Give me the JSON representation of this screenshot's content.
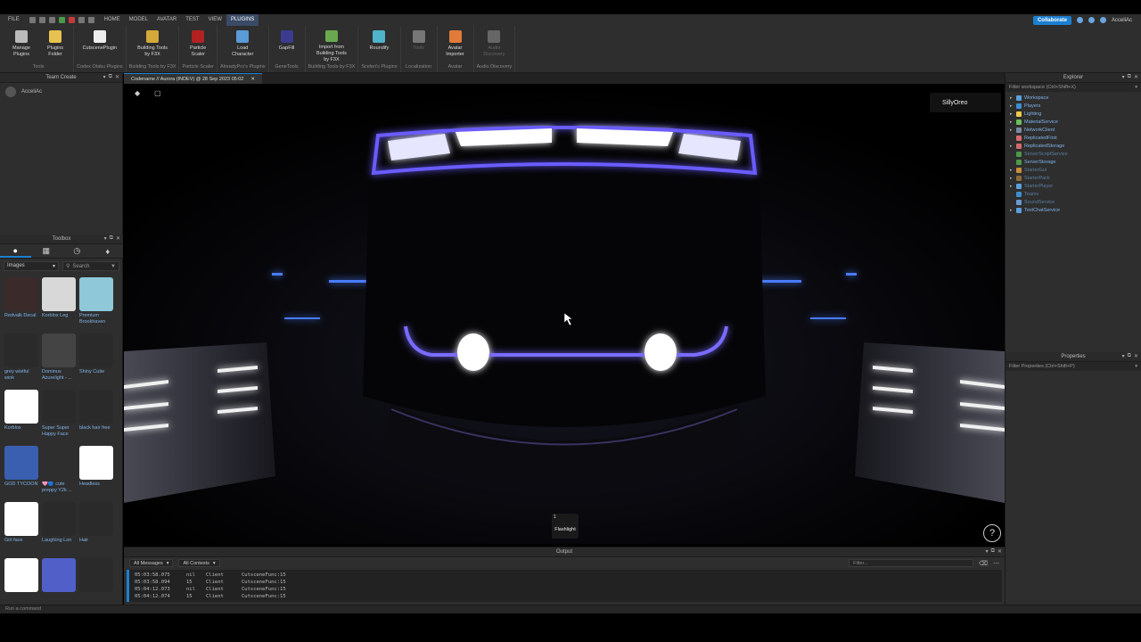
{
  "menu": {
    "items": [
      "FILE",
      "HOME",
      "MODEL",
      "AVATAR",
      "TEST",
      "VIEW",
      "PLUGINS"
    ],
    "active": "PLUGINS",
    "collaborate_label": "Collaborate",
    "username": "AcceliAc"
  },
  "ribbon": {
    "groups": [
      {
        "label": "Tools",
        "buttons": [
          {
            "label": "Manage Plugins",
            "icon": "plugins-gear-icon",
            "color": "#bbbbbb"
          },
          {
            "label": "Plugins Folder",
            "icon": "folder-icon",
            "color": "#e8c250"
          }
        ]
      },
      {
        "label": "Codex Otaku Plugins",
        "buttons": [
          {
            "label": "CutscenePlugin",
            "icon": "camera-icon",
            "color": "#eeeeee"
          }
        ]
      },
      {
        "label": "Building Tools by F3X",
        "buttons": [
          {
            "label": "Building Tools by F3X",
            "icon": "f3x-icon",
            "color": "#d4a93a"
          }
        ]
      },
      {
        "label": "Particle Scaler",
        "buttons": [
          {
            "label": "Particle Scaler",
            "icon": "particle-icon",
            "color": "#b22222"
          }
        ]
      },
      {
        "label": "AlreadyPro's Plugins",
        "buttons": [
          {
            "label": "Load Character",
            "icon": "character-icon",
            "color": "#5a9ad6"
          }
        ]
      },
      {
        "label": "GeneTools",
        "buttons": [
          {
            "label": "GapFill",
            "icon": "gapfill-icon",
            "color": "#3b3b8f"
          }
        ]
      },
      {
        "label": "Building Tools by F3X",
        "buttons": [
          {
            "label": "Import from Building Tools by F3X",
            "icon": "import-icon",
            "color": "#6aa84f"
          }
        ]
      },
      {
        "label": "Sceleri's Plugins",
        "buttons": [
          {
            "label": "Roundify",
            "icon": "roundify-icon",
            "color": "#4fb3c9"
          }
        ]
      },
      {
        "label": "Localization",
        "buttons": [
          {
            "label": "Tools",
            "icon": "localization-icon",
            "color": "#777777",
            "dim": true
          }
        ]
      },
      {
        "label": "Avatar",
        "buttons": [
          {
            "label": "Avatar Importer",
            "icon": "avatar-importer-icon",
            "color": "#e07b39"
          }
        ]
      },
      {
        "label": "Audio Discovery",
        "buttons": [
          {
            "label": "Audio Discovery",
            "icon": "audio-icon",
            "color": "#666666",
            "dim": true
          }
        ]
      }
    ]
  },
  "team_create": {
    "title": "Team Create",
    "user": "AcceliAc"
  },
  "toolbox": {
    "title": "Toolbox",
    "category": "Images",
    "search_placeholder": "Search",
    "items": [
      {
        "name": "Redvalk Decal",
        "color": "#3a2a2a"
      },
      {
        "name": "Korblox Leg",
        "color": "#d8d8d8"
      },
      {
        "name": "Premium Brookhaven",
        "color": "#8fc8d8"
      },
      {
        "name": "grey wistful wink",
        "color": "#2a2a2a"
      },
      {
        "name": "Dominus Azurelight - ...",
        "color": "#444444"
      },
      {
        "name": "Shiny Cutie",
        "color": "#2a2a2a"
      },
      {
        "name": "Korblox",
        "color": "#ffffff"
      },
      {
        "name": "Super Super Happy Face",
        "color": "#2a2a2a"
      },
      {
        "name": "black hair free",
        "color": "#2a2a2a"
      },
      {
        "name": "GOD TYCOON",
        "color": "#3a5fb0"
      },
      {
        "name": "🩷🔵 cute preppy Y2k ...",
        "color": "#2e2e2e"
      },
      {
        "name": "Headless",
        "color": "#ffffff"
      },
      {
        "name": "Girl face",
        "color": "#ffffff"
      },
      {
        "name": "Laughing Lon",
        "color": "#2a2a2a"
      },
      {
        "name": "Hair",
        "color": "#2a2a2a"
      },
      {
        "name": "",
        "color": "#ffffff"
      },
      {
        "name": "",
        "color": "#5060c8"
      },
      {
        "name": "",
        "color": "#2a2a2a"
      }
    ]
  },
  "document_tab": {
    "title": "Codename // Aurora (INDEV) @ 28 Sep 2023 05:02"
  },
  "viewport": {
    "player_name": "SillyOreo",
    "hotbar": {
      "slot": "1",
      "item": "Flashlight"
    },
    "help": "?"
  },
  "explorer": {
    "title": "Explorer",
    "filter_placeholder": "Filter workspace (Ctrl+Shift+X)",
    "items": [
      {
        "name": "Workspace",
        "expandable": true,
        "color": "#5aa0e0"
      },
      {
        "name": "Players",
        "expandable": true,
        "color": "#3a8fd0"
      },
      {
        "name": "Lighting",
        "expandable": true,
        "color": "#f2c94c"
      },
      {
        "name": "MaterialService",
        "expandable": true,
        "color": "#6bbf59"
      },
      {
        "name": "NetworkClient",
        "expandable": true,
        "color": "#7a8ba0"
      },
      {
        "name": "ReplicatedFirst",
        "expandable": false,
        "color": "#d46a6a"
      },
      {
        "name": "ReplicatedStorage",
        "expandable": true,
        "color": "#d46a6a"
      },
      {
        "name": "ServerScriptService",
        "expandable": false,
        "color": "#4a9a4a",
        "dim": true
      },
      {
        "name": "ServerStorage",
        "expandable": false,
        "color": "#4a9a4a"
      },
      {
        "name": "StarterGui",
        "expandable": true,
        "color": "#c98f3c",
        "dim": true
      },
      {
        "name": "StarterPack",
        "expandable": true,
        "color": "#8a6a3a",
        "dim": true
      },
      {
        "name": "StarterPlayer",
        "expandable": true,
        "color": "#5aa0e0",
        "dim": true
      },
      {
        "name": "Teams",
        "expandable": false,
        "color": "#3a8fd0",
        "dim": true
      },
      {
        "name": "SoundService",
        "expandable": false,
        "color": "#6a9ad0",
        "dim": true
      },
      {
        "name": "TextChatService",
        "expandable": true,
        "color": "#5aa0e0"
      }
    ]
  },
  "properties": {
    "title": "Properties",
    "filter_placeholder": "Filter Properties (Ctrl+Shift+P)"
  },
  "output": {
    "title": "Output",
    "messages_select": "All Messages",
    "contexts_select": "All Contexts",
    "filter_placeholder": "Filter...",
    "lines": [
      {
        "time": "05:03:58.075",
        "ctx": "nil",
        "src": "Client",
        "msg": "CutsceneFunc:15"
      },
      {
        "time": "05:03:58.094",
        "ctx": "15",
        "src": "Client",
        "msg": "CutsceneFunc:15"
      },
      {
        "time": "05:04:12.073",
        "ctx": "nil",
        "src": "Client",
        "msg": "CutsceneFunc:15"
      },
      {
        "time": "05:04:12.074",
        "ctx": "15",
        "src": "Client",
        "msg": "CutsceneFunc:15"
      }
    ]
  },
  "command_bar": {
    "placeholder": "Run a command"
  },
  "colors": {
    "accent": "#1c7fd0",
    "neon": "#6a5cff",
    "panel": "#2e2e2e"
  }
}
